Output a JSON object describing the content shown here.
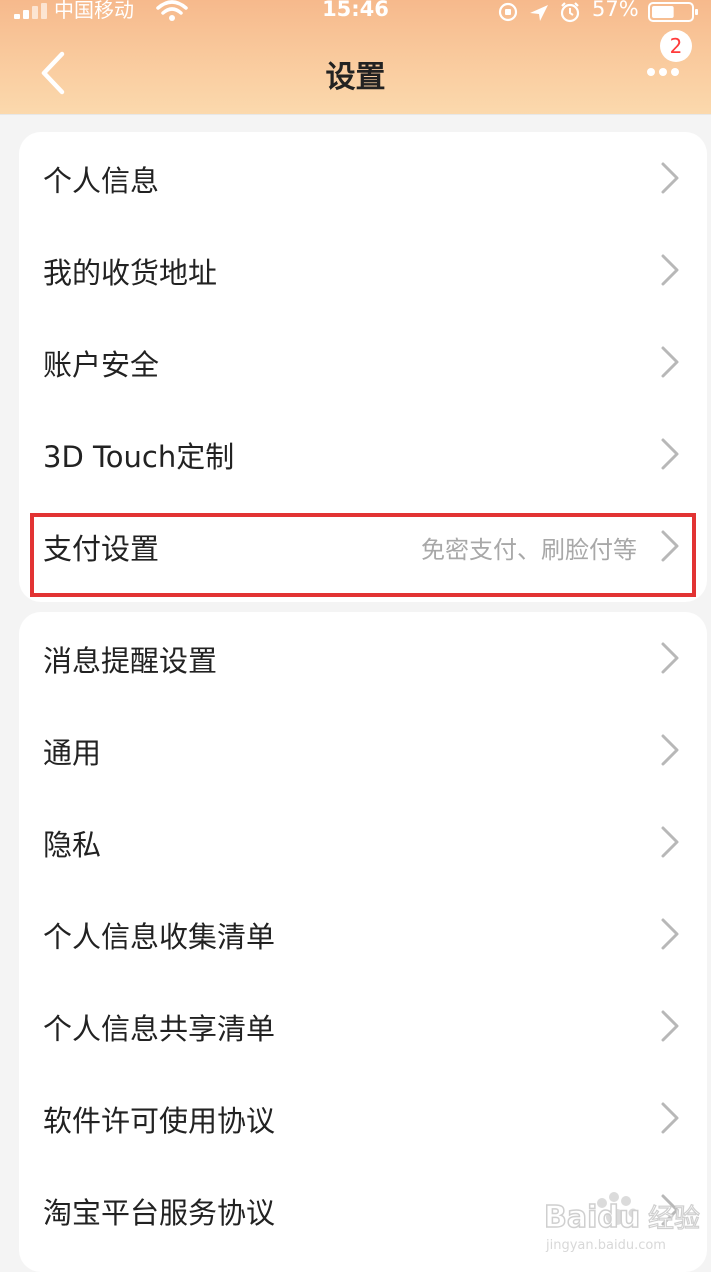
{
  "status_bar": {
    "carrier": "中国移动",
    "time": "15:46",
    "battery_percent": "57%",
    "battery_level": 0.57,
    "icons": [
      "signal-icon",
      "wifi-icon",
      "rotation-lock-icon",
      "location-icon",
      "alarm-icon",
      "battery-icon"
    ]
  },
  "header": {
    "title": "设置",
    "back_icon": "chevron-left-icon",
    "more_icon": "more-dots-icon",
    "badge_count": "2"
  },
  "card1": {
    "items": [
      {
        "label": "个人信息",
        "desc": ""
      },
      {
        "label": "我的收货地址",
        "desc": ""
      },
      {
        "label": "账户安全",
        "desc": ""
      },
      {
        "label": "3D Touch定制",
        "desc": ""
      },
      {
        "label": "支付设置",
        "desc": "免密支付、刷脸付等"
      }
    ]
  },
  "card2": {
    "items": [
      {
        "label": "消息提醒设置"
      },
      {
        "label": "通用"
      },
      {
        "label": "隐私"
      },
      {
        "label": "个人信息收集清单"
      },
      {
        "label": "个人信息共享清单"
      },
      {
        "label": "软件许可使用协议"
      },
      {
        "label": "淘宝平台服务协议"
      }
    ]
  },
  "watermark": {
    "brand": "Baidu",
    "suffix": "经验",
    "url": "jingyan.baidu.com"
  },
  "colors": {
    "header_gradient_top": "#f6b98c",
    "header_gradient_bottom": "#fbd9ad",
    "highlight_border": "#e23333",
    "badge_text": "#ff3b3b",
    "chevron": "#b8b8b8",
    "desc_text": "#a8a8a8"
  }
}
